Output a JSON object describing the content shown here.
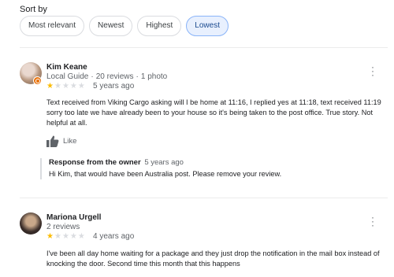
{
  "sort": {
    "label": "Sort by",
    "options": [
      "Most relevant",
      "Newest",
      "Highest",
      "Lowest"
    ],
    "selected": "Lowest"
  },
  "reviews": [
    {
      "name": "Kim Keane",
      "badge": "Local Guide",
      "review_count": "20 reviews",
      "photo_count": "1 photo",
      "rating": 1,
      "max_rating": 5,
      "time": "5 years ago",
      "text": "Text received from Viking Cargo asking will I be home at 11:16, I replied yes at 11:18, text received 11:19 sorry too late we have already been to your house so it's being taken to the post office. True story. Not helpful at all.",
      "like_label": "Like",
      "owner_response": {
        "title": "Response from the owner",
        "time": "5 years ago",
        "text": "Hi Kim, that would have been Australia post. Please remove your review."
      }
    },
    {
      "name": "Mariona Urgell",
      "review_count": "2 reviews",
      "rating": 1,
      "max_rating": 5,
      "time": "4 years ago",
      "text": "I've been all day home waiting for a package and they just drop the notification in the mail box instead of knocking the door. Second time this month that this happens"
    }
  ],
  "colors": {
    "star_filled": "#fbbc04",
    "star_empty": "#dadce0",
    "chip_selected": "#e8f0fe",
    "local_guide_badge": "#e8710a"
  },
  "icons": {
    "more": "vertical-dots-icon",
    "like": "thumbs-up-icon"
  }
}
